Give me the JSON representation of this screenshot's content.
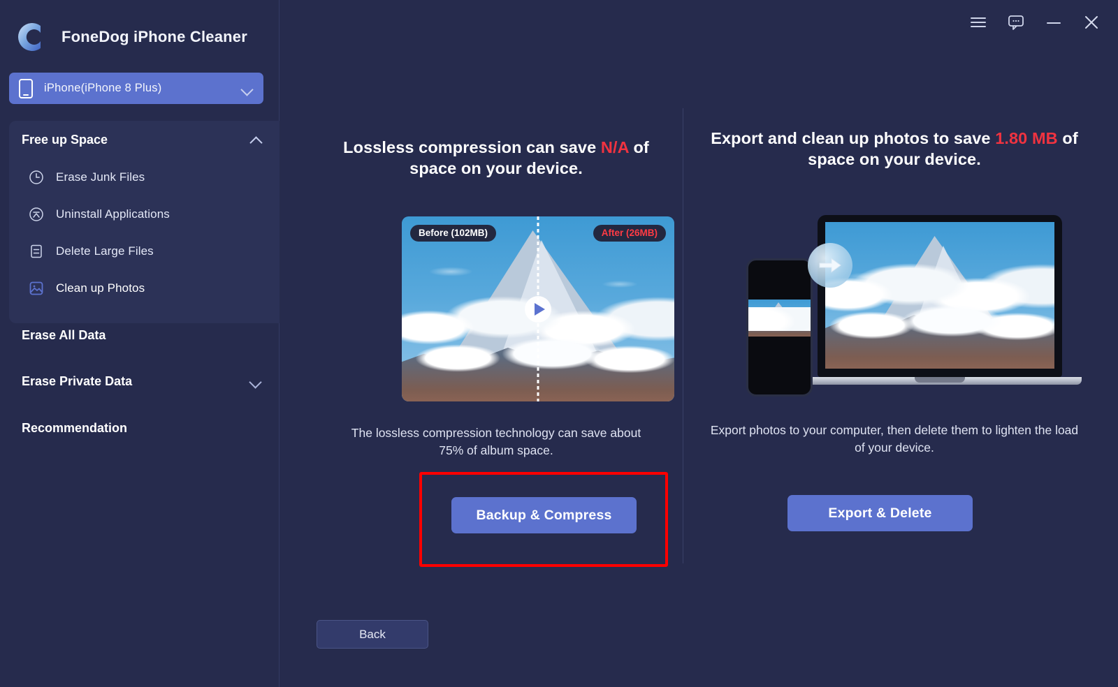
{
  "app": {
    "title": "FoneDog iPhone Cleaner",
    "logo_icon": "fonedog-c-logo"
  },
  "window_controls": [
    {
      "name": "menu-icon",
      "label": "Menu"
    },
    {
      "name": "feedback-icon",
      "label": "Feedback"
    },
    {
      "name": "minimize-icon",
      "label": "Minimize"
    },
    {
      "name": "close-icon",
      "label": "Close"
    }
  ],
  "sidebar": {
    "device_selector": {
      "value": "iPhone(iPhone 8 Plus)",
      "icon": "phone-icon",
      "chevron": "chevron-down-icon"
    },
    "groups": [
      {
        "label": "Free up Space",
        "expanded": true,
        "chevron": "chevron-up-icon",
        "items": [
          {
            "label": "Erase Junk Files",
            "icon": "clock-icon",
            "active": false
          },
          {
            "label": "Uninstall Applications",
            "icon": "app-circle-icon",
            "active": false
          },
          {
            "label": "Delete Large Files",
            "icon": "document-lines-icon",
            "active": false
          },
          {
            "label": "Clean up Photos",
            "icon": "photo-icon",
            "active": true
          }
        ]
      }
    ],
    "sections": [
      {
        "label": "Erase All Data",
        "chevron": null
      },
      {
        "label": "Erase Private Data",
        "chevron": "chevron-down-icon"
      },
      {
        "label": "Recommendation",
        "chevron": null
      }
    ]
  },
  "main": {
    "left_panel": {
      "headline_pre": "Lossless compression can save ",
      "headline_accent": "N/A",
      "headline_post": " of space on your device.",
      "media": {
        "before_label": "Before (102MB)",
        "after_label": "After (26MB)",
        "play_icon": "play-icon"
      },
      "subtext": "The lossless compression technology can save about 75% of album space.",
      "cta_label": "Backup & Compress",
      "highlighted": true
    },
    "right_panel": {
      "headline_pre": "Export and clean up photos to save ",
      "headline_accent": "1.80 MB",
      "headline_post": " of space on your device.",
      "media": {
        "arrow_icon": "arrow-right-icon",
        "devices": [
          "phone-mockup",
          "laptop-mockup"
        ]
      },
      "subtext": "Export photos to your computer, then delete them to lighten the load of your device.",
      "cta_label": "Export & Delete"
    },
    "back_label": "Back"
  },
  "colors": {
    "background": "#262b4d",
    "panel": "#2c3257",
    "accent_blue": "#5c72ce",
    "accent_red": "#f03340",
    "highlight_red": "#fe0000",
    "text_primary": "#ffffff",
    "text_secondary": "#dfe3f2"
  }
}
